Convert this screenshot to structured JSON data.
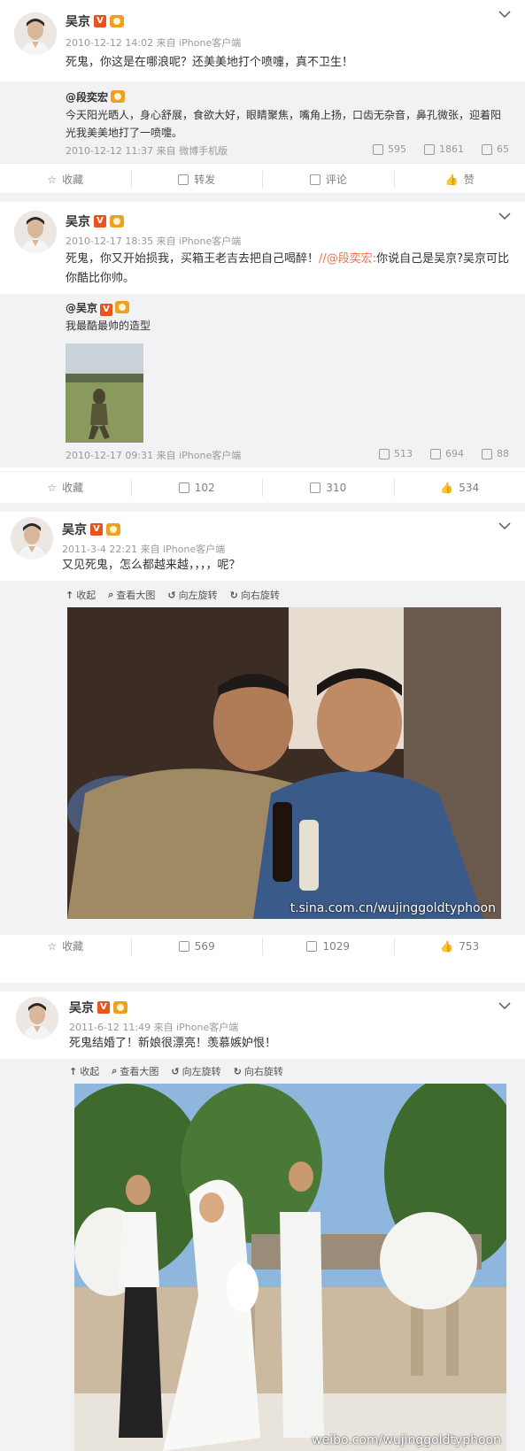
{
  "posts": [
    {
      "author": "吴京",
      "vbadge": "V",
      "meta": "2010-12-12 14:02 来自 iPhone客户端",
      "text": "死鬼，你这是在哪浪呢？还美美地打个喷嚏，真不卫生！",
      "quote": {
        "author": "@段奕宏",
        "text": "今天阳光晒人，身心舒展，食欲大好，眼睛聚焦，嘴角上扬，口齿无杂音，鼻孔微张，迎着阳光我美美地打了一喷嚏。",
        "meta": "2010-12-12 11:37 来自 微博手机版",
        "reposts": "595",
        "comments": "1861",
        "likes": "65"
      },
      "actions": {
        "fav": "收藏",
        "repost": "转发",
        "comment": "评论",
        "like": "赞"
      }
    },
    {
      "author": "吴京",
      "vbadge": "V",
      "meta": "2010-12-17 18:35 来自 iPhone客户端",
      "text_a": "死鬼，你又开始损我，买箱王老吉去把自己喝醉！",
      "text_at": "//@段奕宏:",
      "text_b": "你说自己是吴京?吴京可比你酷比你帅。",
      "quote": {
        "author": "@吴京",
        "text": "我最酷最帅的造型",
        "meta": "2010-12-17 09:31 来自 iPhone客户端",
        "reposts": "513",
        "comments": "694",
        "likes": "88"
      },
      "actions": {
        "fav": "收藏",
        "repost": "102",
        "comment": "310",
        "like": "534"
      }
    },
    {
      "author": "吴京",
      "vbadge": "V",
      "meta": "2011-3-4 22:21 来自 iPhone客户端",
      "text": "又见死鬼，怎么都越来越，，，，呢？",
      "toolbar": [
        "收起",
        "查看大图",
        "向左旋转",
        "向右旋转"
      ],
      "watermark": "t.sina.com.cn/wujinggoldtyphoon",
      "actions": {
        "fav": "收藏",
        "repost": "569",
        "comment": "1029",
        "like": "753"
      }
    },
    {
      "author": "吴京",
      "vbadge": "V",
      "meta": "2011-6-12 11:49 来自 iPhone客户端",
      "text": "死鬼结婚了！新娘很漂亮！羡慕嫉妒恨！",
      "toolbar": [
        "收起",
        "查看大图",
        "向左旋转",
        "向右旋转"
      ],
      "watermark": "weibo.com/wujinggoldtyphoon"
    }
  ],
  "colors": {
    "accent": "#eb7350",
    "bg_gray": "#f2f2f5",
    "badge_v": "#e8541e"
  }
}
